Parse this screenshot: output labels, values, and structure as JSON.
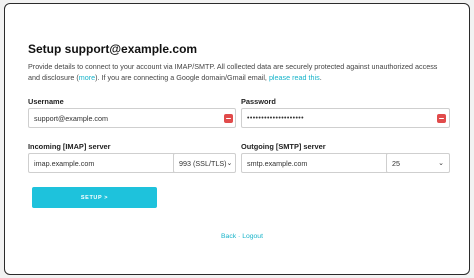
{
  "title": "Setup support@example.com",
  "description": {
    "text1": "Provide details to connect to your account via IMAP/SMTP. All collected data are securely protected against unauthorized access and disclosure (",
    "more_link": "more",
    "text2": "). If you are connecting a Google domain/Gmail email, ",
    "read_link": "please read this",
    "text3": "."
  },
  "username": {
    "label": "Username",
    "value": "support@example.com"
  },
  "password": {
    "label": "Password",
    "value": "••••••••••••••••••••"
  },
  "incoming": {
    "label": "Incoming [IMAP] server",
    "value": "imap.example.com",
    "port": "993 (SSL/TLS)"
  },
  "outgoing": {
    "label": "Outgoing [SMTP] server",
    "value": "smtp.example.com",
    "port": "25"
  },
  "setup_button": "SETUP >",
  "footer": {
    "back": "Back",
    "separator": " · ",
    "logout": "Logout"
  },
  "colors": {
    "accent": "#1ec2dc",
    "link": "#16b3c9",
    "badge": "#e14b4b"
  }
}
